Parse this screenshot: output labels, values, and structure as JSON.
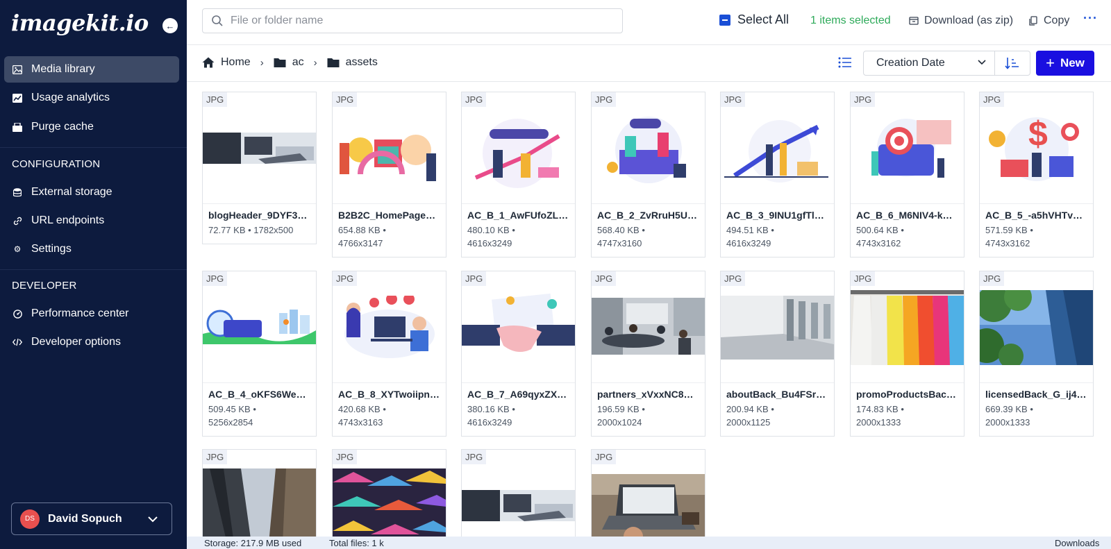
{
  "sidebar": {
    "logo": "imagekit.io",
    "collapse_icon": "arrow-left-icon",
    "main_items": [
      {
        "label": "Media library",
        "icon": "image-icon",
        "active": true
      },
      {
        "label": "Usage analytics",
        "icon": "chart-icon"
      },
      {
        "label": "Purge cache",
        "icon": "cache-icon"
      }
    ],
    "configuration_title": "CONFIGURATION",
    "configuration_items": [
      {
        "label": "External storage",
        "icon": "database-icon"
      },
      {
        "label": "URL endpoints",
        "icon": "link-icon"
      },
      {
        "label": "Settings",
        "icon": "gear-icon"
      }
    ],
    "developer_title": "DEVELOPER",
    "developer_items": [
      {
        "label": "Performance center",
        "icon": "gauge-icon"
      },
      {
        "label": "Developer options",
        "icon": "code-icon"
      }
    ],
    "user": {
      "initials": "DS",
      "name": "David Sopuch"
    }
  },
  "topbar": {
    "search_placeholder": "File or folder name",
    "select_all": "Select All",
    "selected_count": "1 items selected",
    "download": "Download (as zip)",
    "copy": "Copy",
    "more": "···"
  },
  "breadcrumb": [
    {
      "label": "Home",
      "icon": "home-icon"
    },
    {
      "label": "ac",
      "icon": "folder-icon"
    },
    {
      "label": "assets",
      "icon": "folder-icon"
    }
  ],
  "sort": {
    "selected": "Creation Date"
  },
  "new_button": "New",
  "colors": {
    "sidebar": "#0d1b3e",
    "accent": "#1a0fe0",
    "selected_text": "#2eaa5a"
  },
  "files": [
    {
      "type": "JPG",
      "name": "blogHeader_9DYF3…",
      "size": "72.77 KB • 1782x500",
      "dims": ""
    },
    {
      "type": "JPG",
      "name": "B2B2C_HomePage_…",
      "size": "654.88 KB •",
      "dims": "4766x3147"
    },
    {
      "type": "JPG",
      "name": "AC_B_1_AwFUfoZLE…",
      "size": "480.10 KB •",
      "dims": "4616x3249"
    },
    {
      "type": "JPG",
      "name": "AC_B_2_ZvRruH5UP…",
      "size": "568.40 KB •",
      "dims": "4747x3160"
    },
    {
      "type": "JPG",
      "name": "AC_B_3_9INU1gfTlc…",
      "size": "494.51 KB •",
      "dims": "4616x3249"
    },
    {
      "type": "JPG",
      "name": "AC_B_6_M6NIV4-k…",
      "size": "500.64 KB •",
      "dims": "4743x3162"
    },
    {
      "type": "JPG",
      "name": "AC_B_5_-a5hVHTv…",
      "size": "571.59 KB •",
      "dims": "4743x3162"
    },
    {
      "type": "JPG",
      "name": "AC_B_4_oKFS6WeZ…",
      "size": "509.45 KB •",
      "dims": "5256x2854"
    },
    {
      "type": "JPG",
      "name": "AC_B_8_XYTwoiipn…",
      "size": "420.68 KB •",
      "dims": "4743x3163"
    },
    {
      "type": "JPG",
      "name": "AC_B_7_A69qyxZX…",
      "size": "380.16 KB •",
      "dims": "4616x3249"
    },
    {
      "type": "JPG",
      "name": "partners_xVxxNC8Q…",
      "size": "196.59 KB •",
      "dims": "2000x1024"
    },
    {
      "type": "JPG",
      "name": "aboutBack_Bu4FSrD…",
      "size": "200.94 KB •",
      "dims": "2000x1125"
    },
    {
      "type": "JPG",
      "name": "promoProductsBack…",
      "size": "174.83 KB •",
      "dims": "2000x1333"
    },
    {
      "type": "JPG",
      "name": "licensedBack_G_ij4…",
      "size": "669.39 KB •",
      "dims": "2000x1333"
    },
    {
      "type": "JPG",
      "name": "",
      "size": "",
      "dims": ""
    },
    {
      "type": "JPG",
      "name": "",
      "size": "",
      "dims": ""
    },
    {
      "type": "JPG",
      "name": "",
      "size": "",
      "dims": ""
    },
    {
      "type": "JPG",
      "name": "",
      "size": "",
      "dims": ""
    }
  ],
  "footer": {
    "storage": "Storage: 217.9 MB used",
    "total": "Total files: 1 k",
    "downloads": "Downloads"
  }
}
